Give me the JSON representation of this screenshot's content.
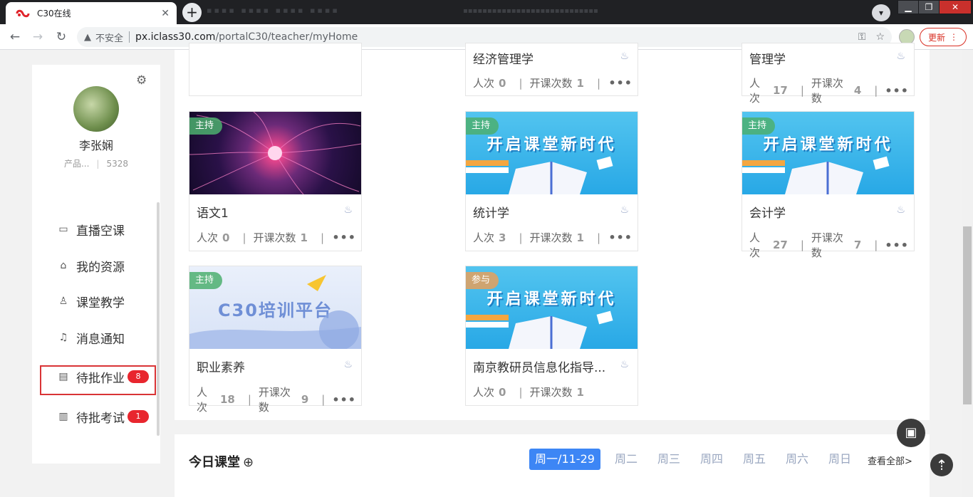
{
  "browser": {
    "tab_title": "C30在线",
    "tab_close": "✕",
    "new_tab": "+",
    "nav_back": "←",
    "nav_forward": "→",
    "nav_reload": "↻",
    "insecure_label": "不安全",
    "url_host": "px.iclass30.com",
    "url_path": "/portalC30/teacher/myHome",
    "update_label": "更新"
  },
  "sidebar": {
    "user_name": "李张娴",
    "user_role": "产品...",
    "user_id": "5328",
    "menu": [
      {
        "label": "直播空课",
        "icon": "monitor-icon"
      },
      {
        "label": "我的资源",
        "icon": "box-icon"
      },
      {
        "label": "课堂教学",
        "icon": "teacher-icon"
      },
      {
        "label": "消息通知",
        "icon": "bell-icon"
      },
      {
        "label": "待批作业",
        "icon": "homework-icon",
        "badge": "8"
      },
      {
        "label": "待批考试",
        "icon": "exam-icon",
        "badge": "1"
      }
    ]
  },
  "courses": {
    "people_label": "人次",
    "sessions_label": "开课次数",
    "items": [
      {
        "title": "经济管理学",
        "people": "0",
        "sessions": "1"
      },
      {
        "title": "管理学",
        "people": "17",
        "sessions": "4"
      },
      {
        "title": "语文1",
        "tag": "主持",
        "people": "0",
        "sessions": "1"
      },
      {
        "title": "统计学",
        "tag": "主持",
        "people": "3",
        "sessions": "1"
      },
      {
        "title": "会计学",
        "tag": "主持",
        "people": "27",
        "sessions": "7"
      },
      {
        "title": "职业素养",
        "tag": "主持",
        "people": "18",
        "sessions": "9"
      },
      {
        "title": "南京教研员信息化指导...",
        "tag": "参与",
        "people": "0",
        "sessions": "1"
      }
    ],
    "banner_new_era": "开启课堂新时代",
    "banner_training": "C30培训平台"
  },
  "today": {
    "title": "今日课堂",
    "days": [
      "周一/11-29",
      "周二",
      "周三",
      "周四",
      "周五",
      "周六",
      "周日"
    ],
    "view_all": "查看全部>"
  },
  "colors": {
    "accent": "#3d86f5",
    "badge": "#e8262e",
    "highlight": "#d93436",
    "tag_host": "#4caf6e",
    "tag_join": "#e6a05a"
  }
}
